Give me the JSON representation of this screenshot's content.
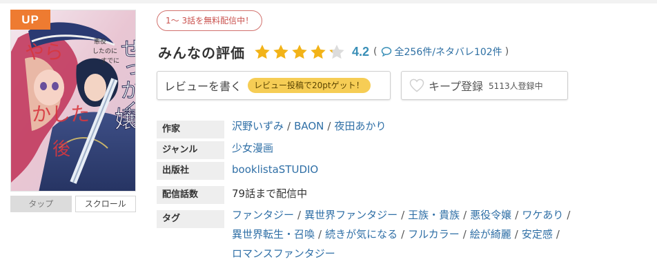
{
  "cover": {
    "badge": "UP",
    "title_text": "せっかく悪役令嬢に憑依したのにすでにやらかした後でした！"
  },
  "view_tabs": [
    {
      "label": "タップ",
      "active": true
    },
    {
      "label": "スクロール",
      "active": false
    }
  ],
  "free_badge": "1〜 3話を無料配信中！",
  "rating": {
    "title": "みんなの評価",
    "score": "4.2",
    "stars_filled": 4,
    "stars_total": 5,
    "total_reviews": "全256件",
    "spoilers": "/ネタバレ102件",
    "paren_open": "(",
    "paren_close": ")"
  },
  "review_button": {
    "label": "レビューを書く",
    "point_badge": "レビュー投稿で20ptゲット！"
  },
  "keep_button": {
    "label": "キープ登録",
    "count": "5113人登録中"
  },
  "info": {
    "author_label": "作家",
    "authors": [
      "沢野いずみ",
      "BAON",
      "夜田あかり"
    ],
    "genre_label": "ジャンル",
    "genre": "少女漫画",
    "publisher_label": "出版社",
    "publisher": "booklistaSTUDIO",
    "episodes_label": "配信話数",
    "episodes": "79話まで配信中",
    "tags_label": "タグ",
    "tags": [
      "ファンタジー",
      "異世界ファンタジー",
      "王族・貴族",
      "悪役令嬢",
      "ワケあり",
      "異世界転生・召喚",
      "続きが気になる",
      "フルカラー",
      "絵が綺麗",
      "安定感",
      "ロマンスファンタジー"
    ]
  },
  "colors": {
    "accent_orange": "#ee7b31",
    "star_gold": "#f2b318",
    "score_blue": "#3a8fb7",
    "link_blue": "#2f6fa6",
    "badge_red": "#c9514d",
    "point_yellow": "#f6cd55"
  },
  "icons": {
    "star": "star-icon",
    "comment": "speech-bubble-icon",
    "heart": "heart-icon"
  }
}
